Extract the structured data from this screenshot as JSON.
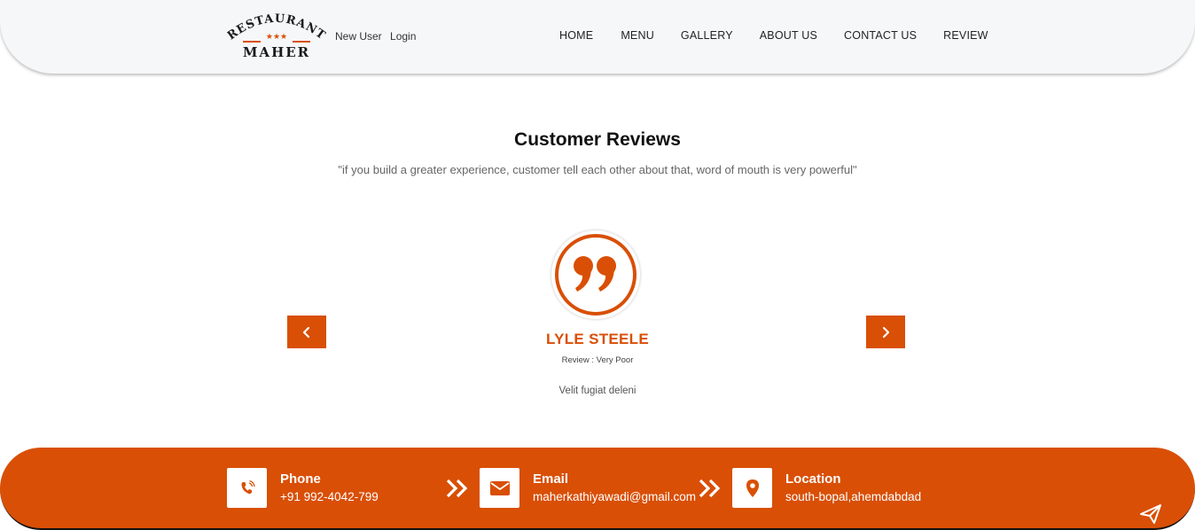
{
  "header": {
    "logo": {
      "top_text": "RESTAURANT",
      "bottom_text": "MAHER",
      "stars": "★★★"
    },
    "user_links": [
      "New User",
      "Login"
    ],
    "nav": [
      "HOME",
      "MENU",
      "GALLERY",
      "ABOUT US",
      "CONTACT US",
      "REVIEW"
    ]
  },
  "reviews": {
    "title": "Customer Reviews",
    "subtitle": "\"if you build a greater experience, customer tell each other about that, word of mouth is very powerful\"",
    "current": {
      "name": "LYLE STEELE",
      "rating": "Review : Very Poor",
      "text": "Velit fugiat deleni"
    },
    "quote_icon": "quote-icon",
    "prev_icon": "chevron-left-icon",
    "next_icon": "chevron-right-icon"
  },
  "contact": {
    "phone": {
      "label": "Phone",
      "value": "+91 992-4042-799",
      "icon": "phone-icon"
    },
    "email": {
      "label": "Email",
      "value": "maherkathiyawadi@gmail.com",
      "icon": "envelope-icon"
    },
    "location": {
      "label": "Location",
      "value": "south-bopal,ahemdabdad",
      "icon": "location-pin-icon"
    },
    "send_icon": "paper-plane-icon"
  },
  "colors": {
    "accent": "#d94f06",
    "header_bg": "#f6f7f9",
    "text_dark": "#111111"
  }
}
